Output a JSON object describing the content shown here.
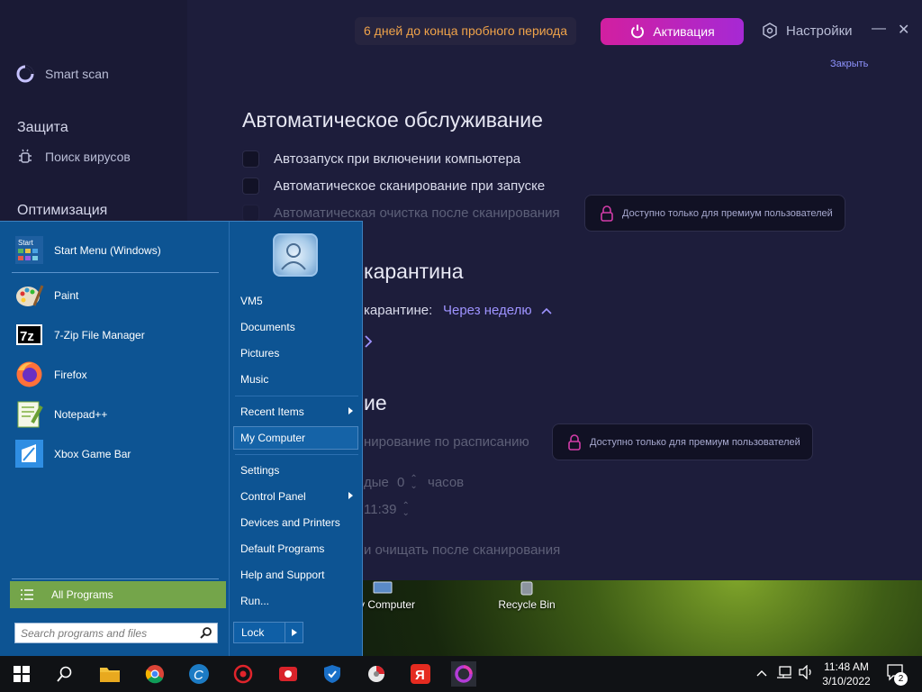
{
  "app": {
    "sidebar": {
      "smart_scan": "Smart scan",
      "protection_header": "Защита",
      "virus_search": "Поиск вирусов",
      "optimization_header": "Оптимизация"
    },
    "topbar": {
      "trial_notice": "6 дней до конца пробного периода",
      "activate_label": "Активация",
      "settings_label": "Настройки",
      "close_link": "Закрыть"
    },
    "auto_maintenance": {
      "title": "Автоматическое обслуживание",
      "options": [
        {
          "label": "Автозапуск при включении компьютера",
          "checked": false,
          "enabled": true
        },
        {
          "label": "Автоматическое сканирование при запуске",
          "checked": false,
          "enabled": true
        },
        {
          "label": "Автоматическая очистка после сканирования",
          "checked": false,
          "enabled": false
        }
      ],
      "premium_badge": "Доступно только для премиум пользователей"
    },
    "quarantine": {
      "title_visible": "карантина",
      "setting_label_visible": "карантине:",
      "setting_value": "Через неделю"
    },
    "schedule": {
      "title_visible": "ие",
      "scheduled_scan_visible": "нирование по расписанию",
      "premium_badge": "Доступно только для премиум пользователей",
      "every_visible": "дые",
      "hours_value": "0",
      "hours_label": "часов",
      "time_value": "11:39",
      "cleanup_visible": "и очищать после сканирования"
    }
  },
  "desktop": {
    "icons": [
      {
        "label": "My Computer"
      },
      {
        "label": "Recycle Bin"
      }
    ]
  },
  "start_menu": {
    "pinned": [
      {
        "label": "Start Menu (Windows)",
        "icon": "start-menu-icon"
      },
      {
        "label": "Paint",
        "icon": "paint-palette-icon"
      },
      {
        "label": "7-Zip File Manager",
        "icon": "7zip-icon"
      },
      {
        "label": "Firefox",
        "icon": "firefox-icon"
      },
      {
        "label": "Notepad++",
        "icon": "notepadpp-icon"
      },
      {
        "label": "Xbox Game Bar",
        "icon": "xbox-game-bar-icon"
      }
    ],
    "all_programs": "All Programs",
    "search_placeholder": "Search programs and files",
    "right": {
      "user": "VM5",
      "documents": "Documents",
      "pictures": "Pictures",
      "music": "Music",
      "recent_items": "Recent Items",
      "my_computer": "My Computer",
      "settings": "Settings",
      "control_panel": "Control Panel",
      "devices_printers": "Devices and Printers",
      "default_programs": "Default Programs",
      "help_support": "Help and Support",
      "run": "Run..."
    },
    "lock_label": "Lock",
    "start_icon_text": "Start"
  },
  "taskbar": {
    "time": "11:48 AM",
    "date": "3/10/2022",
    "notification_count": "2",
    "pinned_icons": [
      "windows-start-icon",
      "search-icon",
      "file-explorer-icon",
      "chrome-icon",
      "ccleaner-icon",
      "antivirus-icon",
      "screen-recorder-icon",
      "defender-shield-icon",
      "disk-cleaner-icon",
      "yandex-icon",
      "app-ring-icon"
    ]
  },
  "colors": {
    "app_bg": "#1d1d3b",
    "trial_text": "#f0a34a",
    "activate_gradient_start": "#d21fa0",
    "activate_gradient_end": "#a629d4",
    "link": "#9e93ff",
    "start_menu_bg": "#0d5493",
    "all_programs_bg": "#74a54a"
  }
}
